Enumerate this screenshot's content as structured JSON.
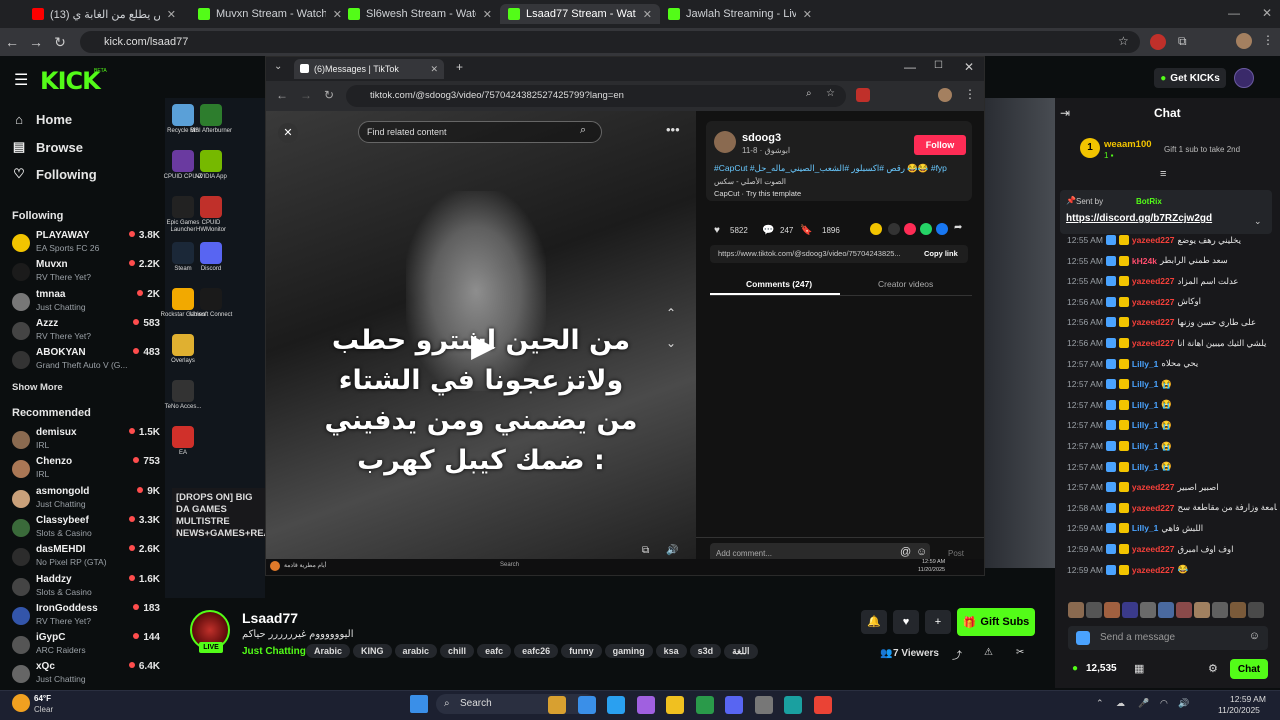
{
  "outer_tabs": [
    {
      "label": "(13) اخر شخص يطلع من الغابة ي"
    },
    {
      "label": "Muvxn Stream - Watch Live on"
    },
    {
      "label": "Sl6wesh Stream - Watch Live o"
    },
    {
      "label": "Lsaad77 Stream - Watch Live o"
    },
    {
      "label": "Jawlah Streaming - Live Stream"
    }
  ],
  "outer_url": "kick.com/lsaad77",
  "kick": {
    "logo": "KICK",
    "logo_sup": "BETA",
    "nav": [
      {
        "label": "Home",
        "icon": "home-icon"
      },
      {
        "label": "Browse",
        "icon": "browse-icon"
      },
      {
        "label": "Following",
        "icon": "heart-icon"
      }
    ],
    "following_title": "Following",
    "following": [
      {
        "name": "PLAYAWAY",
        "sub": "EA Sports FC 26",
        "viewers": "3.8K",
        "color": "#f2c400"
      },
      {
        "name": "Muvxn",
        "sub": "RV There Yet?",
        "viewers": "2.2K",
        "color": "#1b1b1b"
      },
      {
        "name": "tmnaa",
        "sub": "Just Chatting",
        "viewers": "2K",
        "color": "#777"
      },
      {
        "name": "Azzz",
        "sub": "RV There Yet?",
        "viewers": "583",
        "color": "#444"
      },
      {
        "name": "ABOKYAN",
        "sub": "Grand Theft Auto V (G...",
        "viewers": "483",
        "color": "#333"
      }
    ],
    "show_more": "Show More",
    "recommended_title": "Recommended",
    "recommended": [
      {
        "name": "demisux",
        "sub": "IRL",
        "viewers": "1.5K",
        "color": "#8a6a50"
      },
      {
        "name": "Chenzo",
        "sub": "IRL",
        "viewers": "753",
        "color": "#aa7755"
      },
      {
        "name": "asmongold",
        "sub": "Just Chatting",
        "viewers": "9K",
        "color": "#c9a07a"
      },
      {
        "name": "Classybeef",
        "sub": "Slots & Casino",
        "viewers": "3.3K",
        "color": "#3a6a3a"
      },
      {
        "name": "dasMEHDI",
        "sub": "No Pixel RP (GTA)",
        "viewers": "2.6K",
        "color": "#2c2c2c"
      },
      {
        "name": "Haddzy",
        "sub": "Slots & Casino",
        "viewers": "1.6K",
        "color": "#444"
      },
      {
        "name": "IronGoddess",
        "sub": "RV There Yet?",
        "viewers": "183",
        "color": "#3355aa"
      },
      {
        "name": "iGypC",
        "sub": "ARC Raiders",
        "viewers": "144",
        "color": "#555"
      },
      {
        "name": "xQc",
        "sub": "Just Chatting",
        "viewers": "6.4K",
        "color": "#666"
      }
    ],
    "get_kicks": "Get KICKs"
  },
  "desktop_icons": [
    {
      "label": "Recycle Bin",
      "color": "#5aa0d8"
    },
    {
      "label": "MSI Afterburner",
      "color": "#2d7d2d"
    },
    {
      "label": "CPUID CPU-Z",
      "color": "#6a3aa0"
    },
    {
      "label": "NVIDIA App",
      "color": "#76b900"
    },
    {
      "label": "Epic Games Launcher",
      "color": "#222"
    },
    {
      "label": "CPUID HWMonitor",
      "color": "#c0302a"
    },
    {
      "label": "Steam",
      "color": "#1b2838"
    },
    {
      "label": "Discord",
      "color": "#5865f2"
    },
    {
      "label": "Rockstar Games",
      "color": "#f2a900"
    },
    {
      "label": "Ubisoft Connect",
      "color": "#1a1a1a"
    },
    {
      "label": "Overlays",
      "color": "#e0b030"
    },
    {
      "label": "TeNo Acces...",
      "color": "#333"
    },
    {
      "label": "EA",
      "color": "#d0302a"
    }
  ],
  "drops_card": "[DROPS ON] BIG DA GAMES MULTISTRE NEWS+GAMES+REA",
  "tiktok": {
    "tab_title": "(6)Messages | TikTok",
    "url": "tiktok.com/@sdoog3/video/7570424382527425799?lang=en",
    "search_placeholder": "Find related content",
    "subtitles": [
      "من الحين اشترو حطب",
      "ولاتزعجونا في الشتاء",
      "من يضمني ومن يدفيني",
      "ضمك كيبل كهرب :"
    ],
    "author": "sdoog3",
    "date": "11-8 · ابوشوق",
    "follow": "Follow",
    "caption": "#CapCut #رقص #اكسبلور #الشعب_الصيني_ماله_حل 😂😂 #fyp",
    "sound": "الصوت الأصلي - سكس",
    "capcut": "CapCut · Try this template",
    "likes": "5822",
    "comments": "247",
    "saves": "1896",
    "share_url": "https://www.tiktok.com/@sdoog3/video/75704243825...",
    "copy_link": "Copy link",
    "tab_comments": "Comments (247)",
    "tab_creator": "Creator videos",
    "add_comment": "Add comment...",
    "post": "Post",
    "taskbar_weather": "أيام مطرية قادمة",
    "taskbar_time": "12:59 AM",
    "taskbar_date": "11/20/2025",
    "taskbar_search": "Search"
  },
  "chat": {
    "title": "Chat",
    "gifter": "weaam100",
    "gift_text": "Gift 1 sub to take 2nd",
    "gift_count": "1",
    "pinned_sender": "Sent by",
    "pinned_bot": "BotRix",
    "pinned_link": "https://discord.gg/b7RZcjw2gd",
    "messages": [
      {
        "time": "12:55 AM",
        "user": "yazeed227",
        "text": "يخليني رهف يوضع",
        "color": "#f5403a"
      },
      {
        "time": "12:55 AM",
        "user": "kH24k",
        "text": "سعد طمني الرابطر",
        "color": "#ff4d6d"
      },
      {
        "time": "12:55 AM",
        "user": "yazeed227",
        "text": "عدلت اسم المزاد",
        "color": "#f5403a"
      },
      {
        "time": "12:56 AM",
        "user": "yazeed227",
        "text": "اوكاش",
        "color": "#f5403a"
      },
      {
        "time": "12:56 AM",
        "user": "yazeed227",
        "text": "على طاري حسن وزنها",
        "color": "#f5403a"
      },
      {
        "time": "12:56 AM",
        "user": "yazeed227",
        "text": "يلشي الثيك ميبين اهانة انا",
        "color": "#f5403a"
      },
      {
        "time": "12:57 AM",
        "user": "Lilly_1",
        "text": "يحي محلاه",
        "color": "#4aa3ff"
      },
      {
        "time": "12:57 AM",
        "user": "Lilly_1",
        "text": "😭",
        "color": "#4aa3ff"
      },
      {
        "time": "12:57 AM",
        "user": "Lilly_1",
        "text": "😭",
        "color": "#4aa3ff"
      },
      {
        "time": "12:57 AM",
        "user": "Lilly_1",
        "text": "😭",
        "color": "#4aa3ff"
      },
      {
        "time": "12:57 AM",
        "user": "Lilly_1",
        "text": "😭",
        "color": "#4aa3ff"
      },
      {
        "time": "12:57 AM",
        "user": "Lilly_1",
        "text": "😭",
        "color": "#4aa3ff"
      },
      {
        "time": "12:57 AM",
        "user": "yazeed227",
        "text": "اصبير اصبير",
        "color": "#f5403a"
      },
      {
        "time": "12:58 AM",
        "user": "yazeed227",
        "text": "جامعة وزارفة من مقاطعة سح",
        "color": "#f5403a"
      },
      {
        "time": "12:59 AM",
        "user": "Lilly_1",
        "text": "اللبش فاهي",
        "color": "#4aa3ff"
      },
      {
        "time": "12:59 AM",
        "user": "yazeed227",
        "text": "اوف اوف امبرق",
        "color": "#f5403a"
      },
      {
        "time": "12:59 AM",
        "user": "yazeed227",
        "text": "😂",
        "color": "#f5403a"
      }
    ],
    "input_placeholder": "Send a message",
    "kicks": "12,535",
    "chat_button": "Chat"
  },
  "stream": {
    "channel": "Lsaad77",
    "title": "اليووووووم غيرررررر حياكم",
    "category": "Just Chatting",
    "tags": [
      "Arabic",
      "KING",
      "arabic",
      "chill",
      "eafc",
      "eafc26",
      "funny",
      "gaming",
      "ksa",
      "s3d",
      "اللغة"
    ],
    "viewers": "7 Viewers",
    "gift_subs": "Gift Subs",
    "live": "LIVE"
  },
  "taskbar": {
    "temp": "64°F",
    "cond": "Clear",
    "search": "Search",
    "time": "12:59 AM",
    "date": "11/20/2025"
  }
}
